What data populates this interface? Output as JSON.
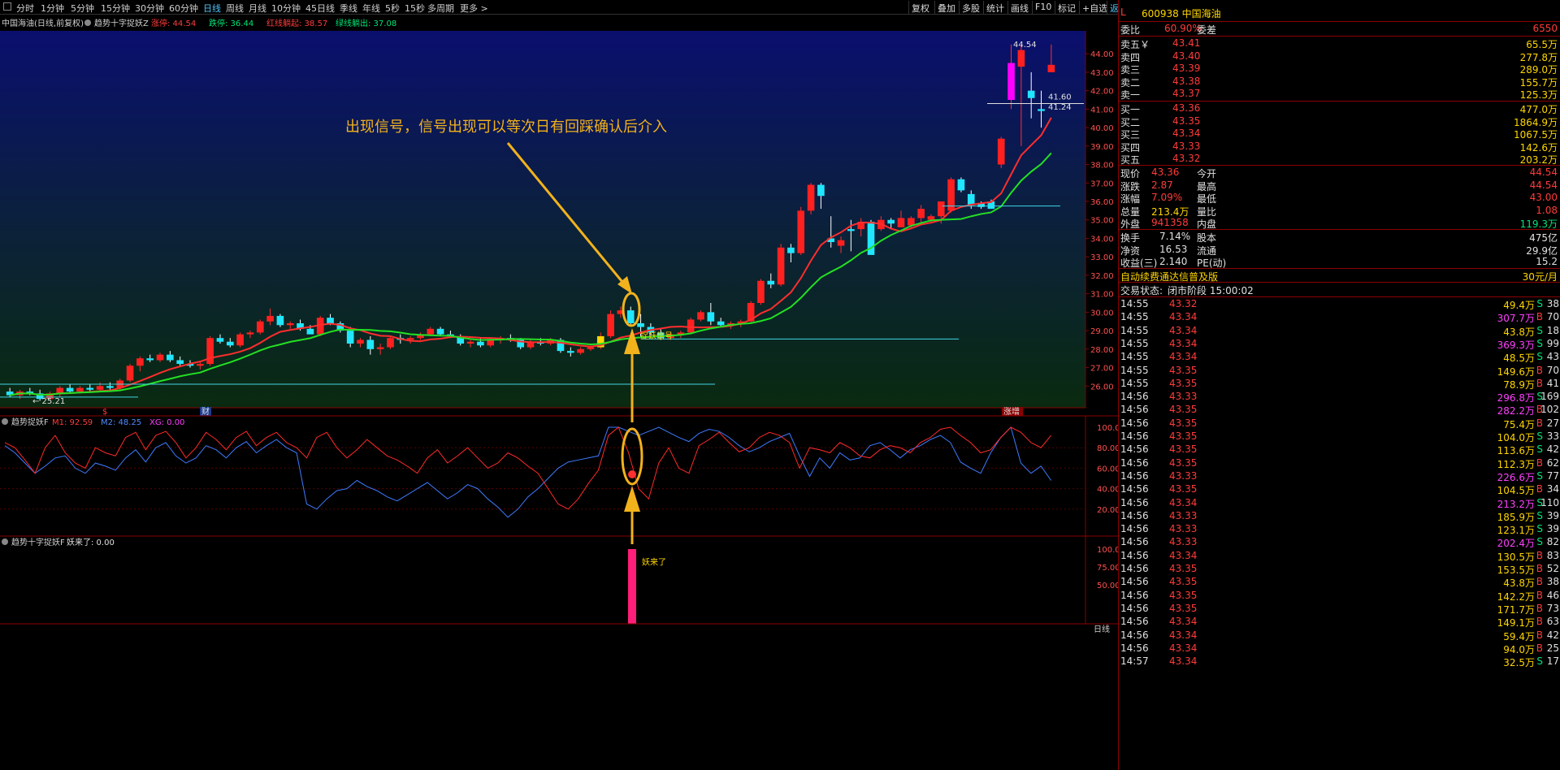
{
  "toolbar": {
    "periods": [
      "分时",
      "1分钟",
      "5分钟",
      "15分钟",
      "30分钟",
      "60分钟",
      "日线",
      "周线",
      "月线",
      "10分钟",
      "45日线",
      "季线",
      "年线",
      "5秒",
      "15秒",
      "多周期",
      "更多 >"
    ],
    "active_period": "日线",
    "right_buttons": [
      "复权",
      "叠加",
      "多股",
      "统计",
      "画线",
      "F10",
      "标记",
      "+自选",
      "返回"
    ]
  },
  "main_chart": {
    "title": "中国海油(日线,前复权)",
    "indicator_name": "趋势十字捉妖Z",
    "legend": [
      {
        "label": "涨停: 44.54",
        "color": "#ff3b3b"
      },
      {
        "label": "跌停: 36.44",
        "color": "#00e676"
      },
      {
        "label": "红线躺起: 38.57",
        "color": "#ff3b3b"
      },
      {
        "label": "绿线躺出: 37.08",
        "color": "#00e676"
      }
    ],
    "y_ticks": [
      "44.00",
      "43.00",
      "42.00",
      "41.00",
      "40.00",
      "39.00",
      "38.00",
      "37.00",
      "36.00",
      "35.00",
      "34.00",
      "33.00",
      "32.00",
      "31.00",
      "30.00",
      "29.00",
      "28.00",
      "27.00",
      "26.00"
    ],
    "annotation": "出现信号，信号出现可以等次日有回踩确认后介入",
    "signal_label": "捉妖信号",
    "high_label": "44.54",
    "low_label": "25.21",
    "price_marks": [
      "41.60",
      "41.24"
    ],
    "bottom_markers": [
      "$",
      "财",
      "涨增"
    ]
  },
  "sub_chart1": {
    "name": "趋势捉妖F",
    "legend": [
      {
        "label": "M1: 92.59",
        "color": "#ff3b3b"
      },
      {
        "label": "M2: 48.25",
        "color": "#4f8cff"
      },
      {
        "label": "XG: 0.00",
        "color": "#ff40ff"
      }
    ],
    "y_ticks": [
      "100.0",
      "80.00",
      "60.00",
      "40.00",
      "20.00"
    ]
  },
  "sub_chart2": {
    "name": "趋势十字捉妖F",
    "legend": [
      {
        "label": "妖来了: 0.00",
        "color": "#e0e0e0"
      }
    ],
    "y_ticks": [
      "100.0",
      "75.00",
      "50.00"
    ],
    "bar_label": "妖来了"
  },
  "x_axis": {
    "label": "日线"
  },
  "quote": {
    "code": "600938",
    "name": "中国海油",
    "tag": "L R 300",
    "weibi_label": "委比",
    "weibi": "60.90%",
    "weicha_label": "委差",
    "weicha": "6550",
    "asks": [
      {
        "label": "卖五￥",
        "price": "43.41",
        "vol": "65.5万"
      },
      {
        "label": "卖四",
        "price": "43.40",
        "vol": "277.8万"
      },
      {
        "label": "卖三",
        "price": "43.39",
        "vol": "289.0万"
      },
      {
        "label": "卖二",
        "price": "43.38",
        "vol": "155.7万"
      },
      {
        "label": "卖一",
        "price": "43.37",
        "vol": "125.3万"
      }
    ],
    "bids": [
      {
        "label": "买一",
        "price": "43.36",
        "vol": "477.0万"
      },
      {
        "label": "买二",
        "price": "43.35",
        "vol": "1864.9万"
      },
      {
        "label": "买三",
        "price": "43.34",
        "vol": "1067.5万"
      },
      {
        "label": "买四",
        "price": "43.33",
        "vol": "142.6万"
      },
      {
        "label": "买五",
        "price": "43.32",
        "vol": "203.2万"
      }
    ],
    "stats": [
      {
        "l1": "现价",
        "v1": "43.36",
        "c1": "red",
        "l2": "今开",
        "v2": "44.54",
        "c2": "red"
      },
      {
        "l1": "涨跌",
        "v1": "2.87",
        "c1": "red",
        "l2": "最高",
        "v2": "44.54",
        "c2": "red"
      },
      {
        "l1": "涨幅",
        "v1": "7.09%",
        "c1": "red",
        "l2": "最低",
        "v2": "43.00",
        "c2": "red"
      },
      {
        "l1": "总量",
        "v1": "213.4万",
        "c1": "yellow",
        "l2": "量比",
        "v2": "1.08",
        "c2": "red"
      },
      {
        "l1": "外盘",
        "v1": "941358",
        "c1": "red",
        "l2": "内盘",
        "v2": "119.3万",
        "c2": "green"
      }
    ],
    "stats2": [
      {
        "l1": "换手",
        "v1": "7.14%",
        "l2": "股本",
        "v2": "475亿"
      },
      {
        "l1": "净资",
        "v1": "16.53",
        "l2": "流通",
        "v2": "29.9亿"
      },
      {
        "l1": "收益(三)",
        "v1": "2.140",
        "l2": "PE(动)",
        "v2": "15.2"
      }
    ],
    "promo": "自动续费通达信普及版",
    "promo_price": "30元/月",
    "status_label": "交易状态:",
    "status": "闭市阶段 15:00:02"
  },
  "ticks": [
    {
      "time": "14:55",
      "price": "43.32",
      "vol": "49.4万",
      "bs": "S",
      "n": "38"
    },
    {
      "time": "14:55",
      "price": "43.34",
      "vol": "307.7万",
      "bs": "B",
      "n": "70"
    },
    {
      "time": "14:55",
      "price": "43.34",
      "vol": "43.8万",
      "bs": "S",
      "n": "18"
    },
    {
      "time": "14:55",
      "price": "43.34",
      "vol": "369.3万",
      "bs": "S",
      "n": "99"
    },
    {
      "time": "14:55",
      "price": "43.34",
      "vol": "48.5万",
      "bs": "S",
      "n": "43"
    },
    {
      "time": "14:55",
      "price": "43.35",
      "vol": "149.6万",
      "bs": "B",
      "n": "70"
    },
    {
      "time": "14:55",
      "price": "43.35",
      "vol": "78.9万",
      "bs": "B",
      "n": "41"
    },
    {
      "time": "14:56",
      "price": "43.33",
      "vol": "296.8万",
      "bs": "S",
      "n": "169"
    },
    {
      "time": "14:56",
      "price": "43.35",
      "vol": "282.2万",
      "bs": "B",
      "n": "102"
    },
    {
      "time": "14:56",
      "price": "43.35",
      "vol": "75.4万",
      "bs": "B",
      "n": "27"
    },
    {
      "time": "14:56",
      "price": "43.35",
      "vol": "104.0万",
      "bs": "S",
      "n": "33"
    },
    {
      "time": "14:56",
      "price": "43.35",
      "vol": "113.6万",
      "bs": "S",
      "n": "42"
    },
    {
      "time": "14:56",
      "price": "43.35",
      "vol": "112.3万",
      "bs": "B",
      "n": "62"
    },
    {
      "time": "14:56",
      "price": "43.33",
      "vol": "226.6万",
      "bs": "S",
      "n": "77"
    },
    {
      "time": "14:56",
      "price": "43.35",
      "vol": "104.5万",
      "bs": "B",
      "n": "34"
    },
    {
      "time": "14:56",
      "price": "43.34",
      "vol": "213.2万",
      "bs": "S",
      "n": "110"
    },
    {
      "time": "14:56",
      "price": "43.33",
      "vol": "185.9万",
      "bs": "S",
      "n": "39"
    },
    {
      "time": "14:56",
      "price": "43.33",
      "vol": "123.1万",
      "bs": "S",
      "n": "39"
    },
    {
      "time": "14:56",
      "price": "43.33",
      "vol": "202.4万",
      "bs": "S",
      "n": "82"
    },
    {
      "time": "14:56",
      "price": "43.34",
      "vol": "130.5万",
      "bs": "B",
      "n": "83"
    },
    {
      "time": "14:56",
      "price": "43.35",
      "vol": "153.5万",
      "bs": "B",
      "n": "52"
    },
    {
      "time": "14:56",
      "price": "43.35",
      "vol": "43.8万",
      "bs": "B",
      "n": "38"
    },
    {
      "time": "14:56",
      "price": "43.35",
      "vol": "142.2万",
      "bs": "B",
      "n": "46"
    },
    {
      "time": "14:56",
      "price": "43.35",
      "vol": "171.7万",
      "bs": "B",
      "n": "73"
    },
    {
      "time": "14:56",
      "price": "43.34",
      "vol": "149.1万",
      "bs": "B",
      "n": "63"
    },
    {
      "time": "14:56",
      "price": "43.34",
      "vol": "59.4万",
      "bs": "B",
      "n": "42"
    },
    {
      "time": "14:56",
      "price": "43.34",
      "vol": "94.0万",
      "bs": "B",
      "n": "25"
    },
    {
      "time": "14:57",
      "price": "43.34",
      "vol": "32.5万",
      "bs": "S",
      "n": "17"
    }
  ],
  "candles": [
    [
      25.7,
      25.9,
      25.4,
      25.5
    ],
    [
      25.5,
      25.8,
      25.3,
      25.7
    ],
    [
      25.7,
      25.9,
      25.5,
      25.6
    ],
    [
      25.6,
      25.8,
      25.2,
      25.3
    ],
    [
      25.3,
      25.7,
      25.2,
      25.6
    ],
    [
      25.6,
      26.0,
      25.4,
      25.9
    ],
    [
      25.9,
      26.1,
      25.6,
      25.7
    ],
    [
      25.7,
      26.0,
      25.6,
      25.9
    ],
    [
      25.9,
      26.1,
      25.7,
      25.8
    ],
    [
      25.8,
      26.2,
      25.7,
      26.0
    ],
    [
      26.0,
      26.2,
      25.8,
      25.9
    ],
    [
      25.9,
      26.4,
      25.8,
      26.3
    ],
    [
      26.3,
      27.2,
      26.2,
      27.1
    ],
    [
      27.1,
      27.6,
      26.8,
      27.5
    ],
    [
      27.5,
      27.7,
      27.3,
      27.4
    ],
    [
      27.4,
      27.8,
      27.3,
      27.7
    ],
    [
      27.7,
      27.9,
      27.3,
      27.4
    ],
    [
      27.4,
      27.6,
      27.1,
      27.2
    ],
    [
      27.2,
      27.4,
      27.0,
      27.1
    ],
    [
      27.1,
      27.3,
      26.9,
      27.2
    ],
    [
      27.2,
      28.7,
      27.1,
      28.6
    ],
    [
      28.6,
      28.8,
      28.3,
      28.4
    ],
    [
      28.4,
      28.6,
      28.1,
      28.2
    ],
    [
      28.2,
      28.9,
      28.1,
      28.8
    ],
    [
      28.8,
      29.0,
      28.6,
      28.9
    ],
    [
      28.9,
      29.6,
      28.8,
      29.5
    ],
    [
      29.5,
      30.2,
      29.3,
      29.8
    ],
    [
      29.8,
      29.9,
      29.2,
      29.3
    ],
    [
      29.3,
      29.5,
      29.1,
      29.4
    ],
    [
      29.4,
      29.6,
      29.0,
      29.1
    ],
    [
      29.1,
      29.3,
      28.9,
      28.8
    ],
    [
      28.8,
      29.8,
      28.7,
      29.7
    ],
    [
      29.7,
      29.9,
      29.3,
      29.4
    ],
    [
      29.4,
      29.5,
      28.9,
      29.0
    ],
    [
      29.0,
      29.2,
      28.1,
      28.3
    ],
    [
      28.3,
      28.6,
      28.1,
      28.5
    ],
    [
      28.5,
      28.7,
      27.7,
      28.0
    ],
    [
      28.0,
      28.3,
      27.7,
      28.1
    ],
    [
      28.1,
      28.7,
      28.0,
      28.6
    ],
    [
      28.6,
      28.8,
      28.3,
      28.5
    ],
    [
      28.5,
      28.7,
      28.3,
      28.6
    ],
    [
      28.6,
      28.9,
      28.5,
      28.8
    ],
    [
      28.8,
      29.2,
      28.7,
      29.1
    ],
    [
      29.1,
      29.2,
      28.7,
      28.8
    ],
    [
      28.8,
      29.0,
      28.6,
      28.7
    ],
    [
      28.7,
      28.8,
      28.2,
      28.3
    ],
    [
      28.3,
      28.5,
      28.1,
      28.4
    ],
    [
      28.4,
      28.6,
      28.1,
      28.2
    ],
    [
      28.2,
      28.6,
      28.1,
      28.5
    ],
    [
      28.5,
      28.7,
      28.3,
      28.6
    ],
    [
      28.6,
      28.8,
      28.4,
      28.5
    ],
    [
      28.5,
      28.6,
      28.0,
      28.1
    ],
    [
      28.1,
      28.5,
      28.0,
      28.4
    ],
    [
      28.4,
      28.6,
      28.2,
      28.3
    ],
    [
      28.3,
      28.6,
      28.2,
      28.5
    ],
    [
      28.5,
      28.6,
      27.8,
      27.9
    ],
    [
      27.9,
      28.1,
      27.6,
      27.8
    ],
    [
      27.8,
      28.1,
      27.7,
      28.0
    ],
    [
      28.0,
      28.2,
      27.9,
      28.1
    ],
    [
      28.1,
      28.9,
      28.0,
      28.7
    ],
    [
      28.7,
      30.1,
      28.6,
      29.9
    ],
    [
      29.9,
      30.3,
      29.7,
      30.1
    ],
    [
      30.1,
      30.3,
      29.3,
      29.4
    ],
    [
      29.4,
      29.9,
      28.6,
      29.2
    ],
    [
      29.2,
      29.4,
      28.7,
      28.9
    ],
    [
      28.9,
      29.1,
      28.5,
      28.6
    ],
    [
      28.6,
      28.9,
      28.5,
      28.8
    ],
    [
      28.8,
      29.0,
      28.6,
      28.9
    ],
    [
      28.9,
      29.7,
      28.8,
      29.6
    ],
    [
      29.6,
      30.1,
      29.5,
      30.0
    ],
    [
      30.0,
      30.5,
      29.3,
      29.5
    ],
    [
      29.5,
      29.7,
      29.2,
      29.3
    ],
    [
      29.3,
      29.5,
      29.1,
      29.4
    ],
    [
      29.4,
      29.6,
      29.2,
      29.5
    ],
    [
      29.5,
      30.6,
      29.4,
      30.5
    ],
    [
      30.5,
      31.8,
      30.4,
      31.7
    ],
    [
      31.7,
      32.1,
      31.3,
      31.5
    ],
    [
      31.5,
      33.7,
      31.4,
      33.5
    ],
    [
      33.5,
      33.7,
      32.7,
      33.2
    ],
    [
      33.2,
      35.7,
      33.1,
      35.5
    ],
    [
      35.5,
      37.0,
      35.3,
      36.9
    ],
    [
      36.9,
      37.0,
      35.6,
      36.3
    ],
    [
      34.0,
      35.2,
      33.5,
      33.8
    ],
    [
      33.6,
      34.1,
      33.2,
      33.9
    ],
    [
      34.5,
      35.0,
      33.3,
      34.4
    ],
    [
      34.5,
      35.1,
      34.1,
      34.9
    ],
    [
      34.9,
      35.0,
      33.7,
      33.1
    ],
    [
      34.5,
      35.2,
      34.4,
      35.0
    ],
    [
      35.0,
      35.1,
      34.5,
      34.8
    ],
    [
      34.6,
      35.5,
      34.6,
      35.1
    ],
    [
      34.7,
      35.2,
      34.5,
      35.1
    ],
    [
      35.1,
      35.8,
      34.8,
      35.6
    ],
    [
      35.0,
      35.3,
      34.9,
      35.2
    ],
    [
      35.2,
      36.0,
      34.8,
      36.0
    ],
    [
      35.5,
      37.3,
      35.4,
      37.2
    ],
    [
      37.2,
      37.3,
      36.5,
      36.6
    ],
    [
      36.4,
      36.6,
      35.6,
      35.8
    ],
    [
      35.9,
      36.0,
      35.6,
      35.7
    ],
    [
      36.0,
      36.1,
      35.7,
      35.6
    ],
    [
      38.0,
      39.5,
      37.8,
      39.4
    ],
    [
      41.5,
      44.5,
      41.0,
      43.5
    ],
    [
      43.3,
      44.5,
      39.0,
      44.2
    ],
    [
      42.0,
      43.0,
      40.5,
      41.6
    ],
    [
      41.0,
      42.0,
      40.0,
      40.9
    ],
    [
      43.0,
      44.5,
      43.0,
      43.4
    ]
  ],
  "candle_dates": "daily",
  "m1": [
    85,
    80,
    68,
    55,
    80,
    92,
    75,
    65,
    60,
    80,
    75,
    72,
    90,
    95,
    78,
    92,
    96,
    85,
    70,
    80,
    95,
    88,
    78,
    90,
    96,
    82,
    90,
    95,
    85,
    80,
    70,
    90,
    95,
    80,
    70,
    78,
    88,
    80,
    72,
    68,
    62,
    55,
    70,
    78,
    65,
    72,
    80,
    70,
    60,
    65,
    75,
    70,
    62,
    55,
    40,
    25,
    20,
    30,
    45,
    58,
    92,
    100,
    75,
    40,
    30,
    65,
    80,
    60,
    55,
    82,
    88,
    95,
    85,
    76,
    80,
    90,
    95,
    92,
    85,
    60,
    80,
    78,
    75,
    85,
    80,
    72,
    70,
    78,
    82,
    80,
    75,
    85,
    90,
    98,
    100,
    92,
    85,
    75,
    78,
    90,
    100,
    95,
    85,
    80,
    92
  ],
  "m2": [
    82,
    75,
    65,
    55,
    62,
    70,
    72,
    60,
    55,
    65,
    62,
    58,
    70,
    78,
    66,
    80,
    85,
    72,
    65,
    70,
    82,
    78,
    70,
    80,
    86,
    75,
    82,
    88,
    80,
    75,
    25,
    20,
    30,
    38,
    40,
    48,
    42,
    38,
    32,
    28,
    34,
    40,
    46,
    38,
    30,
    36,
    44,
    40,
    30,
    22,
    12,
    20,
    32,
    40,
    50,
    60,
    66,
    68,
    70,
    72,
    100,
    100,
    96,
    92,
    96,
    100,
    95,
    90,
    86,
    94,
    98,
    96,
    90,
    82,
    76,
    80,
    86,
    90,
    94,
    72,
    52,
    70,
    60,
    75,
    68,
    70,
    82,
    85,
    78,
    70,
    78,
    82,
    88,
    92,
    85,
    66,
    60,
    55,
    75,
    90,
    100,
    65,
    55,
    62,
    48
  ]
}
